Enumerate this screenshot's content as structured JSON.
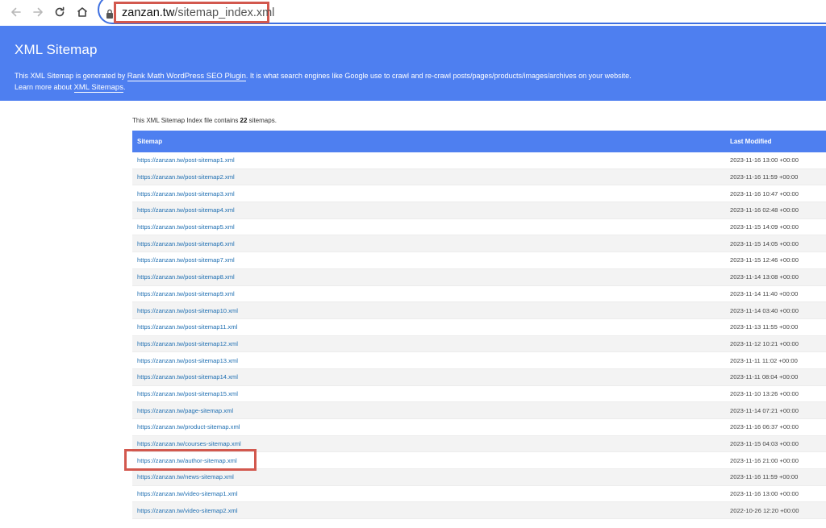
{
  "browser": {
    "url_host": "zanzan.tw",
    "url_path": "/sitemap_index.xml",
    "icons": [
      "back-icon",
      "forward-icon",
      "reload-icon",
      "home-icon",
      "lock-icon"
    ]
  },
  "banner": {
    "title": "XML Sitemap",
    "line1_prefix": "This XML Sitemap is generated by ",
    "line1_link": "Rank Math WordPress SEO Plugin",
    "line1_suffix": ". It is what search engines like Google use to crawl and re-crawl posts/pages/products/images/archives on your website.",
    "line2_prefix": "Learn more about ",
    "line2_link": "XML Sitemaps",
    "line2_suffix": ".",
    "background": "#4e7ff0"
  },
  "summary": {
    "prefix": "This XML Sitemap Index file contains ",
    "count": "22",
    "suffix": " sitemaps."
  },
  "table": {
    "headers": {
      "sitemap": "Sitemap",
      "last_modified": "Last Modified"
    },
    "rows": [
      {
        "url": "https://zanzan.tw/post-sitemap1.xml",
        "modified": "2023-11-16 13:00 +00:00"
      },
      {
        "url": "https://zanzan.tw/post-sitemap2.xml",
        "modified": "2023-11-16 11:59 +00:00"
      },
      {
        "url": "https://zanzan.tw/post-sitemap3.xml",
        "modified": "2023-11-16 10:47 +00:00"
      },
      {
        "url": "https://zanzan.tw/post-sitemap4.xml",
        "modified": "2023-11-16 02:48 +00:00"
      },
      {
        "url": "https://zanzan.tw/post-sitemap5.xml",
        "modified": "2023-11-15 14:09 +00:00"
      },
      {
        "url": "https://zanzan.tw/post-sitemap6.xml",
        "modified": "2023-11-15 14:05 +00:00"
      },
      {
        "url": "https://zanzan.tw/post-sitemap7.xml",
        "modified": "2023-11-15 12:46 +00:00"
      },
      {
        "url": "https://zanzan.tw/post-sitemap8.xml",
        "modified": "2023-11-14 13:08 +00:00"
      },
      {
        "url": "https://zanzan.tw/post-sitemap9.xml",
        "modified": "2023-11-14 11:40 +00:00"
      },
      {
        "url": "https://zanzan.tw/post-sitemap10.xml",
        "modified": "2023-11-14 03:40 +00:00"
      },
      {
        "url": "https://zanzan.tw/post-sitemap11.xml",
        "modified": "2023-11-13 11:55 +00:00"
      },
      {
        "url": "https://zanzan.tw/post-sitemap12.xml",
        "modified": "2023-11-12 10:21 +00:00"
      },
      {
        "url": "https://zanzan.tw/post-sitemap13.xml",
        "modified": "2023-11-11 11:02 +00:00"
      },
      {
        "url": "https://zanzan.tw/post-sitemap14.xml",
        "modified": "2023-11-11 08:04 +00:00"
      },
      {
        "url": "https://zanzan.tw/post-sitemap15.xml",
        "modified": "2023-11-10 13:26 +00:00"
      },
      {
        "url": "https://zanzan.tw/page-sitemap.xml",
        "modified": "2023-11-14 07:21 +00:00"
      },
      {
        "url": "https://zanzan.tw/product-sitemap.xml",
        "modified": "2023-11-16 06:37 +00:00"
      },
      {
        "url": "https://zanzan.tw/courses-sitemap.xml",
        "modified": "2023-11-15 04:03 +00:00"
      },
      {
        "url": "https://zanzan.tw/author-sitemap.xml",
        "modified": "2023-11-16 21:00 +00:00"
      },
      {
        "url": "https://zanzan.tw/news-sitemap.xml",
        "modified": "2023-11-16 11:59 +00:00"
      },
      {
        "url": "https://zanzan.tw/video-sitemap1.xml",
        "modified": "2023-11-16 13:00 +00:00"
      },
      {
        "url": "https://zanzan.tw/video-sitemap2.xml",
        "modified": "2022-10-26 12:20 +00:00"
      }
    ]
  },
  "annotation_color": "#d2584e"
}
